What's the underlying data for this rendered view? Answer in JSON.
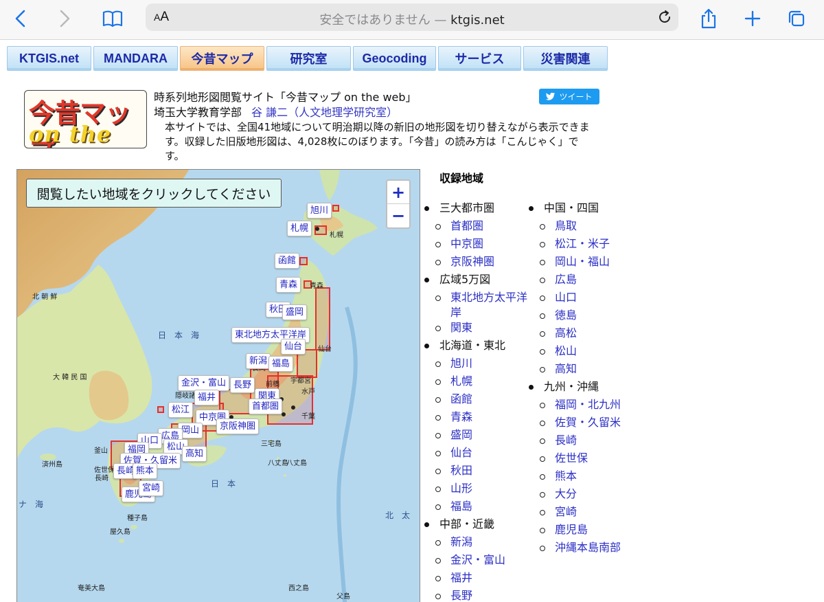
{
  "browser": {
    "aa_label": "AA",
    "url_prefix": "安全ではありません — ",
    "url_host": "ktgis.net"
  },
  "tabs": [
    {
      "label": "KTGIS.net",
      "active": false
    },
    {
      "label": "MANDARA",
      "active": false
    },
    {
      "label": "今昔マップ",
      "active": true
    },
    {
      "label": "研究室",
      "active": false
    },
    {
      "label": "Geocoding",
      "active": false
    },
    {
      "label": "サービス",
      "active": false
    },
    {
      "label": "災害関連",
      "active": false
    }
  ],
  "header": {
    "logo_line1": "今昔マップ",
    "logo_line2": "on the web",
    "site_title": "時系列地形図閲覧サイト「今昔マップ on the web」",
    "affiliation": "埼玉大学教育学部",
    "author_link": "谷 謙二（人文地理学研究室）",
    "description": "本サイトでは、全国41地域について明治期以降の新旧の地形図を切り替えながら表示できます。収録した旧版地形図は、4,028枚にのぼります。「今昔」の読み方は「こんじゃく」です。",
    "tweet_label": "ツイート"
  },
  "map": {
    "instruction": "閲覧したい地域をクリックしてください",
    "zoom_in": "+",
    "zoom_out": "−",
    "labels": [
      "旭川",
      "札幌",
      "函館",
      "青森",
      "秋田",
      "盛岡",
      "東北地方太平洋岸",
      "仙台",
      "新潟",
      "福島",
      "金沢・富山",
      "長野",
      "福井",
      "関東",
      "松江",
      "首都圏",
      "中京圏",
      "京阪神圏",
      "岡山",
      "広島",
      "山口",
      "松山",
      "高知",
      "福岡",
      "佐賀・久留米",
      "長崎",
      "熊本",
      "鹿児島",
      "宮崎"
    ],
    "geo_text": [
      "北 朝 鮮",
      "大 韓 民 国",
      "日　本　海",
      "日　本",
      "北　太",
      "ナ　海",
      "八丈島",
      "西之島",
      "父島",
      "種子島",
      "屋久島",
      "奄美大島",
      "釜山",
      "済州島",
      "青森",
      "札幌",
      "仙台",
      "長岡",
      "前橋",
      "宇都宮",
      "水戸",
      "千葉",
      "三宅島",
      "八丈島",
      "隠岐諸島",
      "佐世保",
      "長崎"
    ],
    "colors": {
      "sea": "#b6d8ee",
      "land": "#cfe5b0",
      "highland": "#e8c58a",
      "box": "#e4302b"
    }
  },
  "regions": {
    "title": "収録地域",
    "col1": [
      {
        "category": "三大都市圏",
        "items": [
          "首都圏",
          "中京圏",
          "京阪神圏"
        ]
      },
      {
        "category": "広域5万図",
        "items": [
          "東北地方太平洋岸",
          "関東"
        ]
      },
      {
        "category": "北海道・東北",
        "items": [
          "旭川",
          "札幌",
          "函館",
          "青森",
          "盛岡",
          "仙台",
          "秋田",
          "山形",
          "福島"
        ]
      },
      {
        "category": "中部・近畿",
        "items": [
          "新潟",
          "金沢・富山",
          "福井",
          "長野"
        ]
      }
    ],
    "col2": [
      {
        "category": "中国・四国",
        "items": [
          "鳥取",
          "松江・米子",
          "岡山・福山",
          "広島",
          "山口",
          "徳島",
          "高松",
          "松山",
          "高知"
        ]
      },
      {
        "category": "九州・沖縄",
        "items": [
          "福岡・北九州",
          "佐賀・久留米",
          "長崎",
          "佐世保",
          "熊本",
          "大分",
          "宮崎",
          "鹿児島",
          "沖縄本島南部"
        ]
      }
    ]
  }
}
